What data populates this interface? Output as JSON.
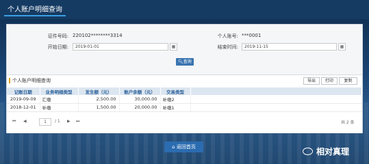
{
  "header": {
    "title": "个人账户明细查询"
  },
  "form": {
    "id_label": "证件号码:",
    "id_value": "220102********3314",
    "account_label": "个人账号:",
    "account_value": "***0001",
    "start_label": "开始日期:",
    "start_value": "2019-01-01",
    "end_label": "结束时间:",
    "end_value": "2019-11-15",
    "query_label": "查询"
  },
  "details": {
    "title": "个人账户明细查询",
    "export_label": "导出",
    "print_label": "打印",
    "copy_label": "复制",
    "columns": [
      "记账日期",
      "业务明细类型",
      "发生额（元）",
      "账户余额（元）",
      "交易类型"
    ],
    "rows": [
      [
        "2019-09-09",
        "汇缴",
        "2,500.00",
        "30,000.00",
        "补缴2"
      ],
      [
        "2018-12-01",
        "补缴",
        "1,500.00",
        "20,000.00",
        "补缴1"
      ]
    ]
  },
  "pager": {
    "first": "⏮",
    "prev": "◀",
    "page": "1",
    "total_pages": "/ 1",
    "next": "▶",
    "last": "⏭",
    "summary": "共 2 条"
  },
  "footer": {
    "back_label": "返回首页"
  },
  "watermark": {
    "text": "相对真理"
  },
  "colors": {
    "header": "#153b63",
    "accent": "#3aa0e6",
    "button": "#3a74b0"
  }
}
